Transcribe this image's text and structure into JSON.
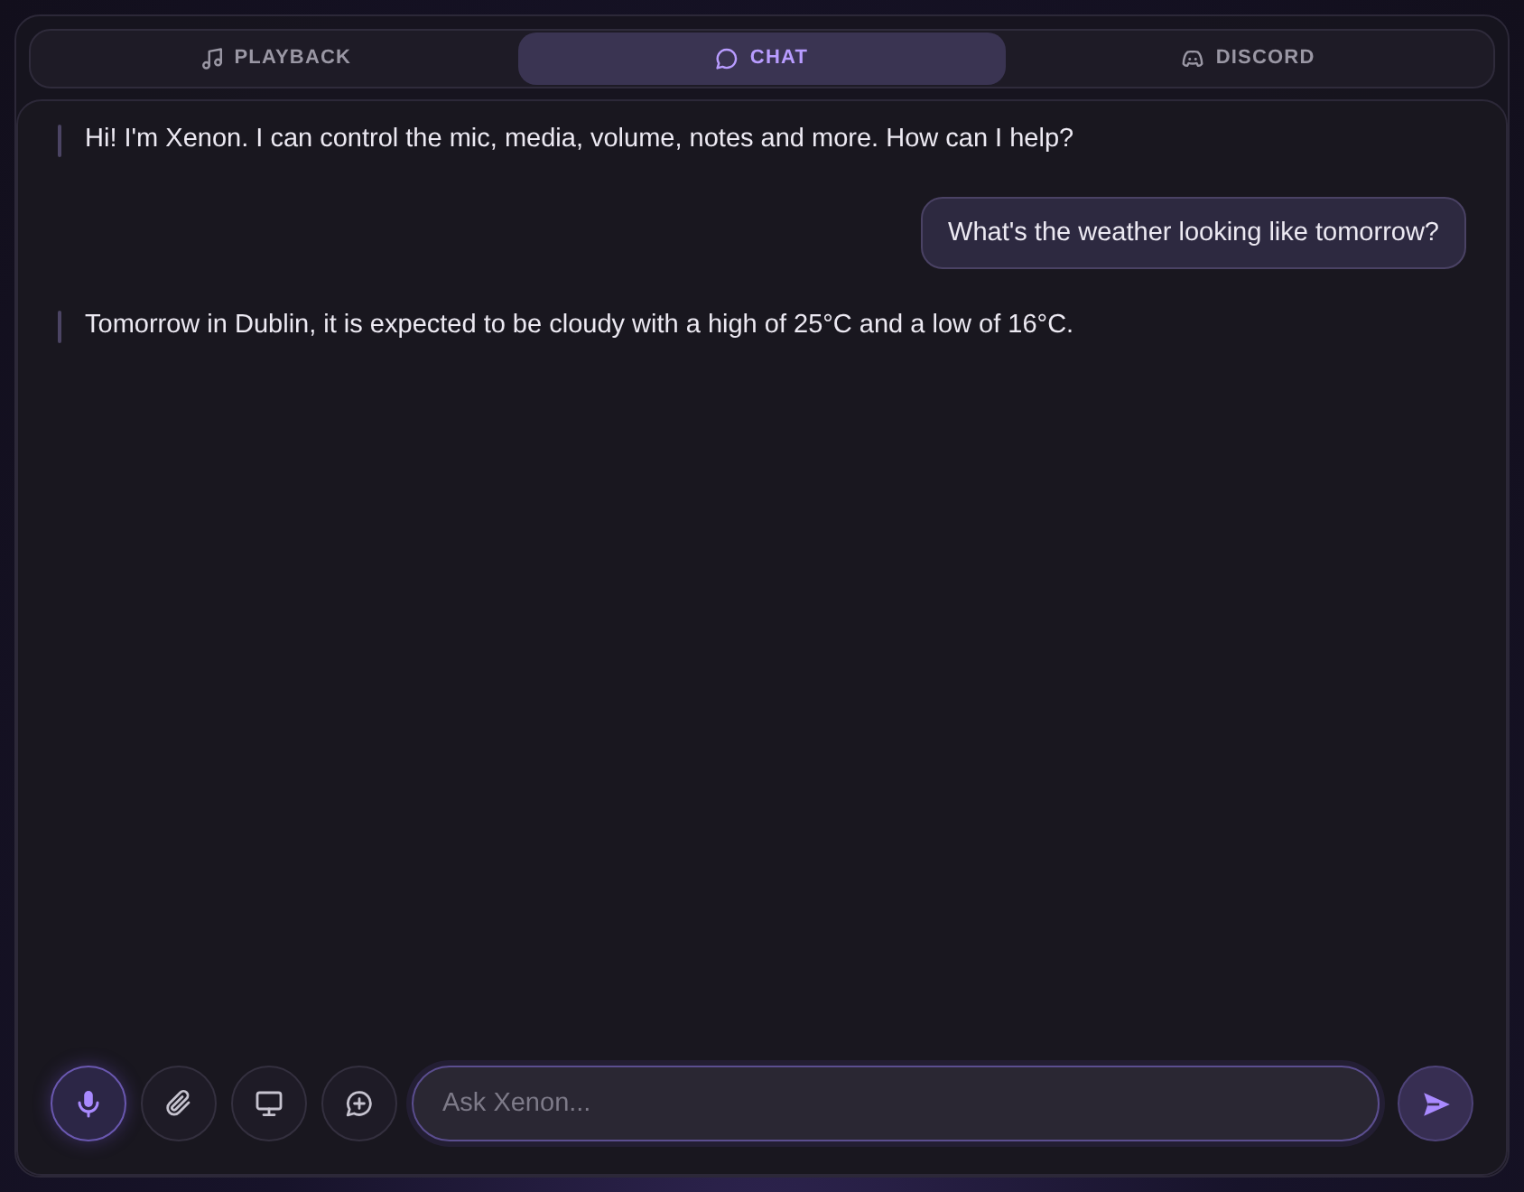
{
  "tabs": [
    {
      "kind": "music",
      "label": "PLAYBACK",
      "selected": false
    },
    {
      "kind": "chat",
      "label": "CHAT",
      "selected": true
    },
    {
      "kind": "gamepad",
      "label": "DISCORD",
      "selected": false
    }
  ],
  "messages": [
    {
      "kind": "assistant",
      "text": "Hi! I'm Xenon. I can control the mic, media, volume, notes and more. How can I help?"
    },
    {
      "kind": "user",
      "text": "What's the weather looking like tomorrow?"
    },
    {
      "kind": "assistant",
      "text": "Tomorrow in Dublin, it is expected to be cloudy with a high of 25°C and a low of 16°C."
    }
  ],
  "composer": {
    "tools": [
      {
        "kind": "mic",
        "on": true
      },
      {
        "kind": "attach",
        "on": false
      },
      {
        "kind": "screen",
        "on": false
      },
      {
        "kind": "new-chat",
        "on": false
      }
    ],
    "input": {
      "placeholder": "Ask Xenon..."
    }
  }
}
